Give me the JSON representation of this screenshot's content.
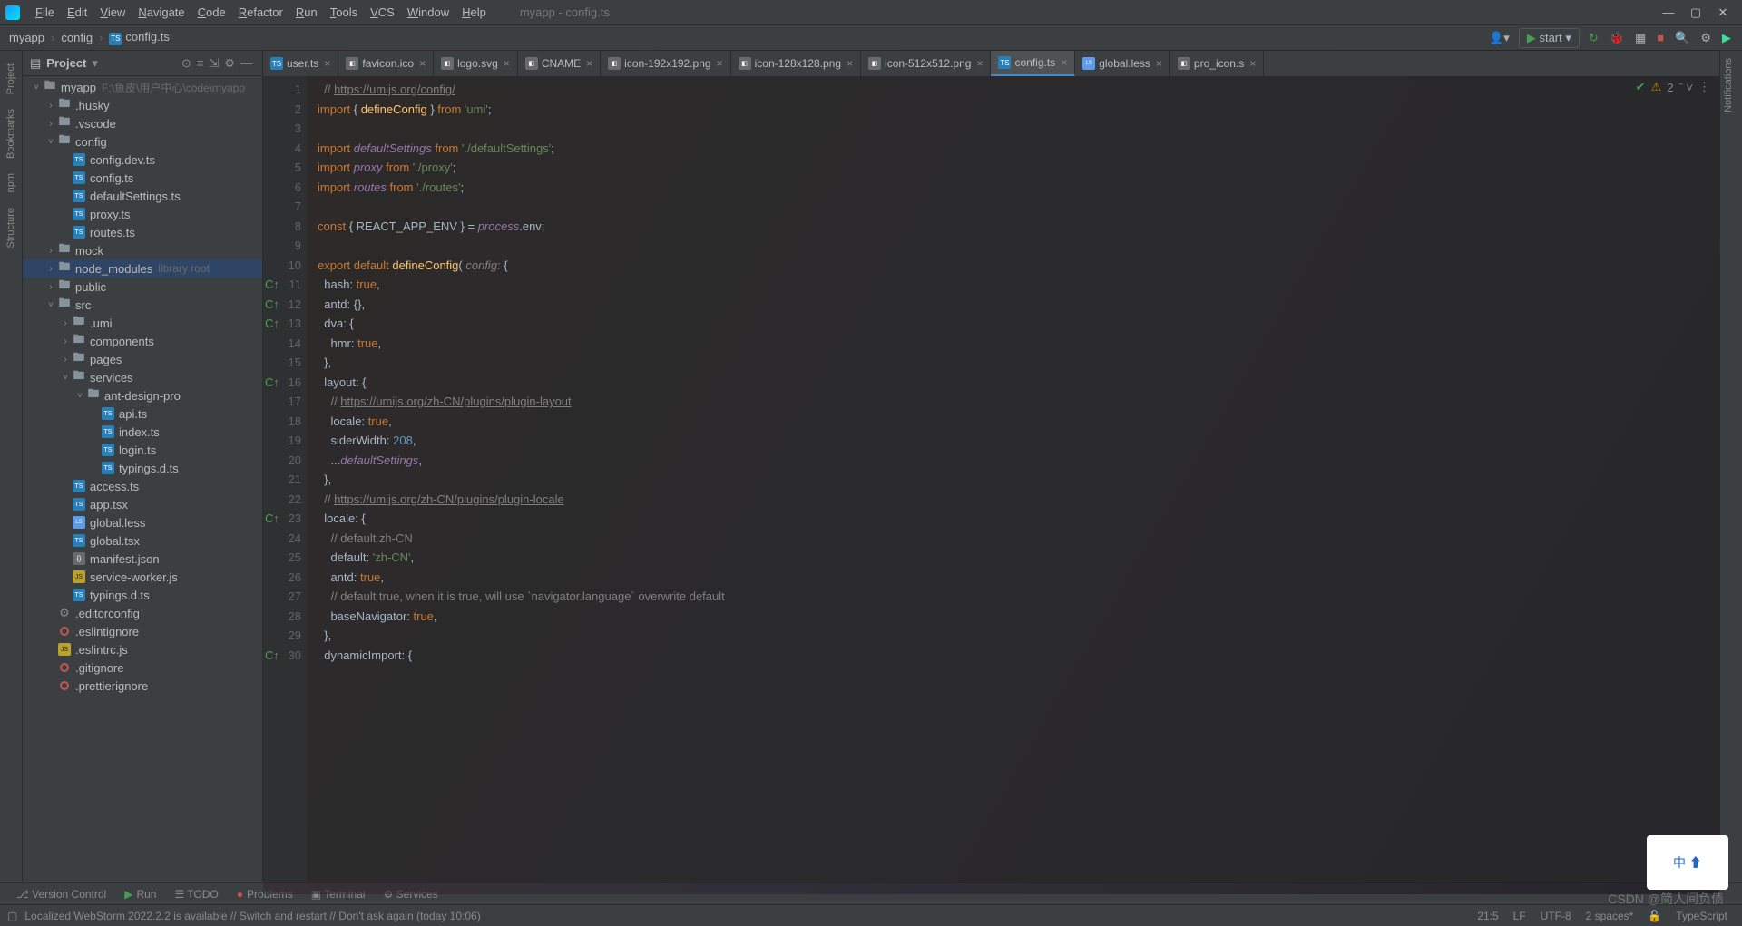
{
  "window_title": "myapp - config.ts",
  "menu": [
    "File",
    "Edit",
    "View",
    "Navigate",
    "Code",
    "Refactor",
    "Run",
    "Tools",
    "VCS",
    "Window",
    "Help"
  ],
  "breadcrumbs": [
    "myapp",
    "config",
    "config.ts"
  ],
  "run_config": "start",
  "panel": {
    "title": "Project"
  },
  "tree": [
    {
      "d": 0,
      "arrow": "v",
      "ico": "folder root",
      "lbl": "myapp",
      "hint": "F:\\鱼皮\\用户中心\\code\\myapp"
    },
    {
      "d": 1,
      "arrow": ">",
      "ico": "folder",
      "lbl": ".husky"
    },
    {
      "d": 1,
      "arrow": ">",
      "ico": "folder",
      "lbl": ".vscode"
    },
    {
      "d": 1,
      "arrow": "v",
      "ico": "folder",
      "lbl": "config"
    },
    {
      "d": 2,
      "ico": "ts",
      "lbl": "config.dev.ts"
    },
    {
      "d": 2,
      "ico": "ts",
      "lbl": "config.ts"
    },
    {
      "d": 2,
      "ico": "ts",
      "lbl": "defaultSettings.ts"
    },
    {
      "d": 2,
      "ico": "ts",
      "lbl": "proxy.ts"
    },
    {
      "d": 2,
      "ico": "ts",
      "lbl": "routes.ts"
    },
    {
      "d": 1,
      "arrow": ">",
      "ico": "folder",
      "lbl": "mock"
    },
    {
      "d": 1,
      "arrow": ">",
      "ico": "folder",
      "lbl": "node_modules",
      "hint": "library root",
      "lib": true,
      "sel": true
    },
    {
      "d": 1,
      "arrow": ">",
      "ico": "folder",
      "lbl": "public"
    },
    {
      "d": 1,
      "arrow": "v",
      "ico": "folder",
      "lbl": "src"
    },
    {
      "d": 2,
      "arrow": ">",
      "ico": "folder",
      "lbl": ".umi"
    },
    {
      "d": 2,
      "arrow": ">",
      "ico": "folder",
      "lbl": "components"
    },
    {
      "d": 2,
      "arrow": ">",
      "ico": "folder",
      "lbl": "pages"
    },
    {
      "d": 2,
      "arrow": "v",
      "ico": "folder",
      "lbl": "services"
    },
    {
      "d": 3,
      "arrow": "v",
      "ico": "folder",
      "lbl": "ant-design-pro"
    },
    {
      "d": 4,
      "ico": "ts",
      "lbl": "api.ts"
    },
    {
      "d": 4,
      "ico": "ts",
      "lbl": "index.ts"
    },
    {
      "d": 4,
      "ico": "ts",
      "lbl": "login.ts"
    },
    {
      "d": 4,
      "ico": "ts",
      "lbl": "typings.d.ts"
    },
    {
      "d": 2,
      "ico": "ts",
      "lbl": "access.ts"
    },
    {
      "d": 2,
      "ico": "ts",
      "lbl": "app.tsx"
    },
    {
      "d": 2,
      "ico": "less",
      "lbl": "global.less"
    },
    {
      "d": 2,
      "ico": "ts",
      "lbl": "global.tsx"
    },
    {
      "d": 2,
      "ico": "json",
      "lbl": "manifest.json"
    },
    {
      "d": 2,
      "ico": "js",
      "lbl": "service-worker.js"
    },
    {
      "d": 2,
      "ico": "ts",
      "lbl": "typings.d.ts"
    },
    {
      "d": 1,
      "ico": "gear",
      "lbl": ".editorconfig"
    },
    {
      "d": 1,
      "ico": "dot",
      "lbl": ".eslintignore"
    },
    {
      "d": 1,
      "ico": "js",
      "lbl": ".eslintrc.js"
    },
    {
      "d": 1,
      "ico": "dot",
      "lbl": ".gitignore"
    },
    {
      "d": 1,
      "ico": "dot",
      "lbl": ".prettierignore"
    }
  ],
  "tabs": [
    {
      "lbl": "user.ts",
      "ico": "ts"
    },
    {
      "lbl": "favicon.ico",
      "ico": "img"
    },
    {
      "lbl": "logo.svg",
      "ico": "img"
    },
    {
      "lbl": "CNAME",
      "ico": "txt"
    },
    {
      "lbl": "icon-192x192.png",
      "ico": "img"
    },
    {
      "lbl": "icon-128x128.png",
      "ico": "img"
    },
    {
      "lbl": "icon-512x512.png",
      "ico": "img"
    },
    {
      "lbl": "config.ts",
      "ico": "ts",
      "active": true
    },
    {
      "lbl": "global.less",
      "ico": "less"
    },
    {
      "lbl": "pro_icon.s",
      "ico": "img"
    }
  ],
  "inspection": {
    "warnings": "2"
  },
  "code_lines": [
    {
      "n": 1,
      "html": "  <span class='cm'>// <a>https://umijs.org/config/</a></span>"
    },
    {
      "n": 2,
      "html": "<span class='kw'>import</span> { <span class='fn'>defineConfig</span> } <span class='kw'>from</span> <span class='str'>'umi'</span>;"
    },
    {
      "n": 3,
      "html": ""
    },
    {
      "n": 4,
      "html": "<span class='kw'>import</span> <span class='id'>defaultSettings</span> <span class='kw'>from</span> <span class='str'>'./defaultSettings'</span>;"
    },
    {
      "n": 5,
      "html": "<span class='kw'>import</span> <span class='id'>proxy</span> <span class='kw'>from</span> <span class='str'>'./proxy'</span>;"
    },
    {
      "n": 6,
      "html": "<span class='kw'>import</span> <span class='id'>routes</span> <span class='kw'>from</span> <span class='str'>'./routes'</span>;"
    },
    {
      "n": 7,
      "html": ""
    },
    {
      "n": 8,
      "html": "<span class='kw'>const</span> { <span class='prop'>REACT_APP_ENV</span> } = <span class='id'>process</span>.env;"
    },
    {
      "n": 9,
      "html": ""
    },
    {
      "n": 10,
      "html": "<span class='kw'>export default</span> <span class='fn'>defineConfig</span>( <span class='param'>config:</span> {"
    },
    {
      "n": 11,
      "mk": "c",
      "html": "  <span class='prop'>hash</span>: <span class='true'>true</span>,"
    },
    {
      "n": 12,
      "mk": "c",
      "html": "  <span class='prop'>antd</span>: {},"
    },
    {
      "n": 13,
      "mk": "c",
      "html": "  <span class='prop'>dva</span>: {"
    },
    {
      "n": 14,
      "html": "    <span class='prop'>hmr</span>: <span class='true'>true</span>,"
    },
    {
      "n": 15,
      "html": "  },"
    },
    {
      "n": 16,
      "mk": "c",
      "html": "  <span class='prop'>layout</span>: {"
    },
    {
      "n": 17,
      "html": "    <span class='cm'>// <a>https://umijs.org/zh-CN/plugins/plugin-layout</a></span>"
    },
    {
      "n": 18,
      "html": "    <span class='prop'>locale</span>: <span class='true'>true</span>,"
    },
    {
      "n": 19,
      "html": "    <span class='prop'>siderWidth</span>: <span class='num'>208</span>,"
    },
    {
      "n": 20,
      "html": "    ...<span class='id'>defaultSettings</span>,"
    },
    {
      "n": 21,
      "html": "  },"
    },
    {
      "n": 22,
      "html": "  <span class='cm'>// <a>https://umijs.org/zh-CN/plugins/plugin-locale</a></span>"
    },
    {
      "n": 23,
      "mk": "c",
      "html": "  <span class='prop'>locale</span>: {"
    },
    {
      "n": 24,
      "html": "    <span class='cm'>// default zh-CN</span>"
    },
    {
      "n": 25,
      "html": "    <span class='prop'>default</span>: <span class='str'>'zh-CN'</span>,"
    },
    {
      "n": 26,
      "html": "    <span class='prop'>antd</span>: <span class='true'>true</span>,"
    },
    {
      "n": 27,
      "html": "    <span class='cm'>// default true, when it is true, will use `navigator.language` overwrite default</span>"
    },
    {
      "n": 28,
      "html": "    <span class='prop'>baseNavigator</span>: <span class='true'>true</span>,"
    },
    {
      "n": 29,
      "html": "  },"
    },
    {
      "n": 30,
      "mk": "c",
      "html": "  <span class='prop'>dynamicImport</span>: {"
    }
  ],
  "toolwins": [
    "Version Control",
    "Run",
    "TODO",
    "Problems",
    "Terminal",
    "Services"
  ],
  "status": {
    "msg": "Localized WebStorm 2022.2.2 is available // Switch and restart // Don't ask again (today 10:06)",
    "pos": "21:5",
    "lf": "LF",
    "enc": "UTF-8",
    "indent": "2 spaces*",
    "lang": "TypeScript"
  },
  "left_tools": [
    "Project",
    "Bookmarks",
    "npm",
    "Structure"
  ],
  "right_tools": [
    "Notifications"
  ],
  "watermark": "CSDN @简人间负债",
  "badge": "中 ⬆"
}
